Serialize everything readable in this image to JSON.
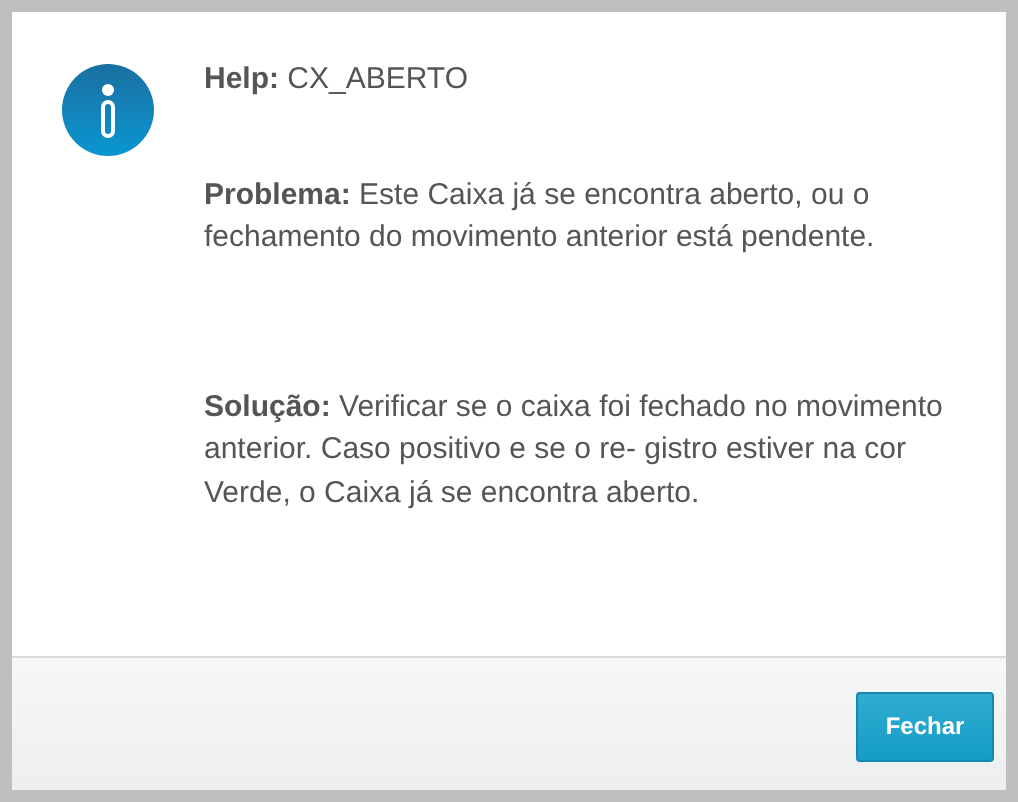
{
  "dialog": {
    "help": "**Help:** CX_ABERTO",
    "problem": "**Problema:** Este Caixa já se encontra aberto, ou o fechamento do movimento anterior está pendente.",
    "solution": "**Solução:** Verificar se o caixa foi fechado no movimento anterior. Caso positivo e se o re- gistro estiver na cor Verde, o Caixa já se encontra aberto.",
    "buttons": [
      "Fechar"
    ]
  }
}
